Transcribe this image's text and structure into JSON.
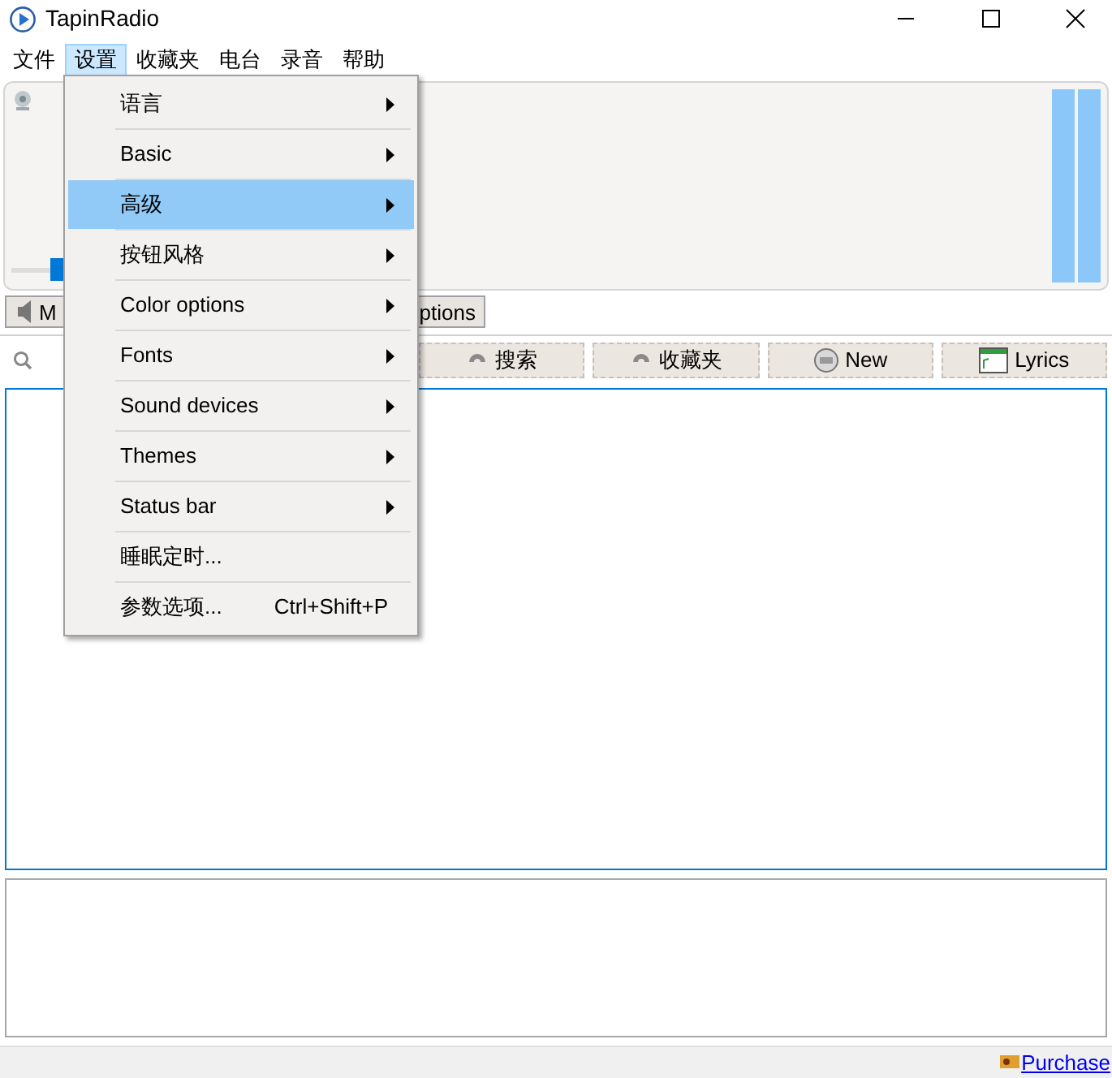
{
  "window": {
    "title": "TapinRadio"
  },
  "menu_bar": [
    {
      "label": "文件",
      "selected": false
    },
    {
      "label": "设置",
      "selected": true
    },
    {
      "label": "收藏夹",
      "selected": false
    },
    {
      "label": "电台",
      "selected": false
    },
    {
      "label": "录音",
      "selected": false
    },
    {
      "label": "帮助",
      "selected": false
    }
  ],
  "player": {
    "volume": {
      "level": 0.12
    },
    "meters": [
      {
        "level": 1
      },
      {
        "level": 1
      }
    ]
  },
  "tabs": [
    {
      "label": "M"
    },
    {
      "label": "ptions"
    }
  ],
  "toolbar": [
    {
      "label": "搜索",
      "kind": "swirl"
    },
    {
      "label": "收藏夹",
      "kind": "swirl"
    },
    {
      "label": "New",
      "kind": "radio"
    },
    {
      "label": "Lyrics",
      "kind": "window"
    }
  ],
  "status_bar": {
    "link": "Purchase"
  },
  "dropdown": [
    {
      "label": "语言",
      "submenu": true,
      "selected": false
    },
    {
      "label": "Basic",
      "submenu": true,
      "selected": false
    },
    {
      "label": "高级",
      "submenu": true,
      "selected": true
    },
    {
      "label": "按钮风格",
      "submenu": true,
      "selected": false
    },
    {
      "label": "Color options",
      "submenu": true,
      "selected": false
    },
    {
      "label": "Fonts",
      "submenu": true,
      "selected": false
    },
    {
      "label": "Sound devices",
      "submenu": true,
      "selected": false
    },
    {
      "label": "Themes",
      "submenu": true,
      "selected": false
    },
    {
      "label": "Status bar",
      "submenu": true,
      "selected": false
    },
    {
      "label": "睡眠定时...",
      "submenu": false,
      "selected": false
    },
    {
      "label": "参数选项...",
      "shortcut": "Ctrl+Shift+P",
      "submenu": false,
      "selected": false
    }
  ]
}
